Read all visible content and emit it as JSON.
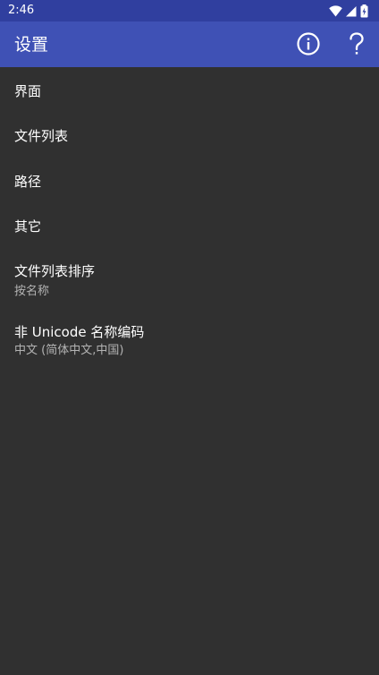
{
  "status_bar": {
    "time": "2:46",
    "icons": [
      "wifi-icon",
      "cell-signal-icon",
      "battery-icon"
    ]
  },
  "app_bar": {
    "title": "设置",
    "actions": [
      "info-icon",
      "help-icon"
    ],
    "background": "#3f51b5"
  },
  "settings": {
    "items": [
      {
        "label": "界面"
      },
      {
        "label": "文件列表"
      },
      {
        "label": "路径"
      },
      {
        "label": "其它"
      },
      {
        "label": "文件列表排序",
        "summary": "按名称"
      },
      {
        "label": "非 Unicode 名称编码",
        "summary": "中文 (简体中文,中国)"
      }
    ]
  },
  "colors": {
    "status_bar": "#303f9f",
    "background": "#303030",
    "primary_text": "#ffffff",
    "secondary_text": "#b3b3b3"
  }
}
